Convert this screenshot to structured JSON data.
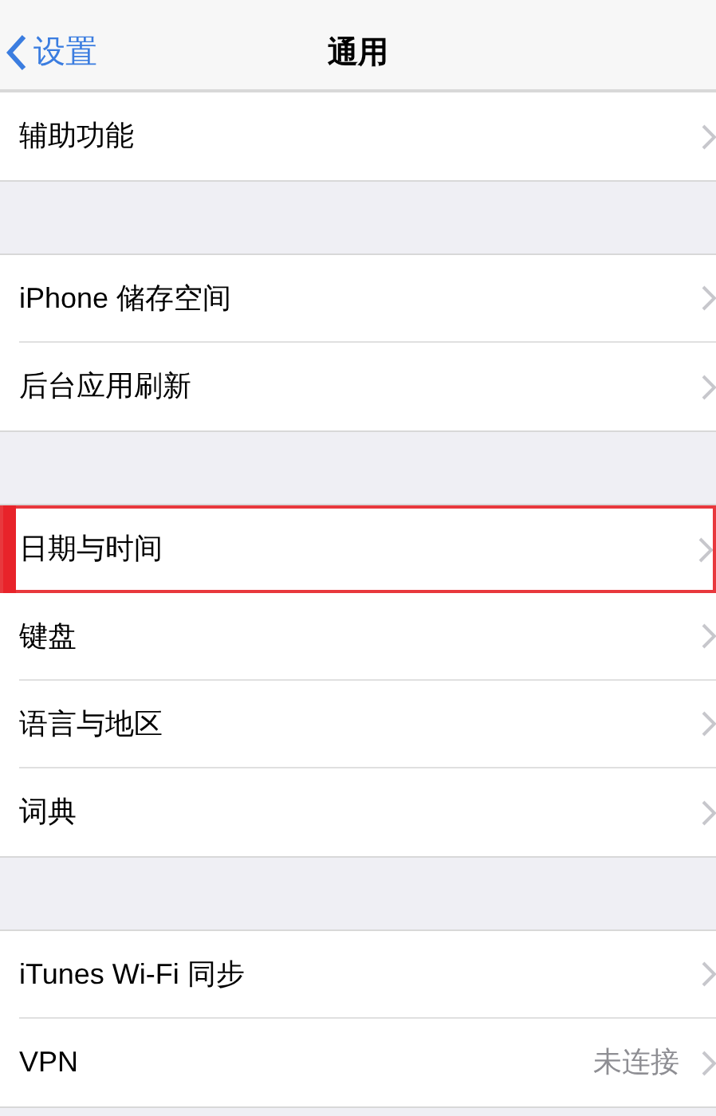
{
  "nav": {
    "back": "设置",
    "title": "通用"
  },
  "sections": [
    {
      "rows": [
        {
          "label": "辅助功能",
          "highlighted": false
        }
      ]
    },
    {
      "rows": [
        {
          "label": "iPhone 储存空间",
          "highlighted": false
        },
        {
          "label": "后台应用刷新",
          "highlighted": false
        }
      ]
    },
    {
      "rows": [
        {
          "label": "日期与时间",
          "highlighted": true
        },
        {
          "label": "键盘",
          "highlighted": false
        },
        {
          "label": "语言与地区",
          "highlighted": false
        },
        {
          "label": "词典",
          "highlighted": false
        }
      ]
    },
    {
      "rows": [
        {
          "label": "iTunes Wi-Fi 同步",
          "highlighted": false
        },
        {
          "label": "VPN",
          "value": "未连接",
          "highlighted": false
        }
      ]
    }
  ]
}
